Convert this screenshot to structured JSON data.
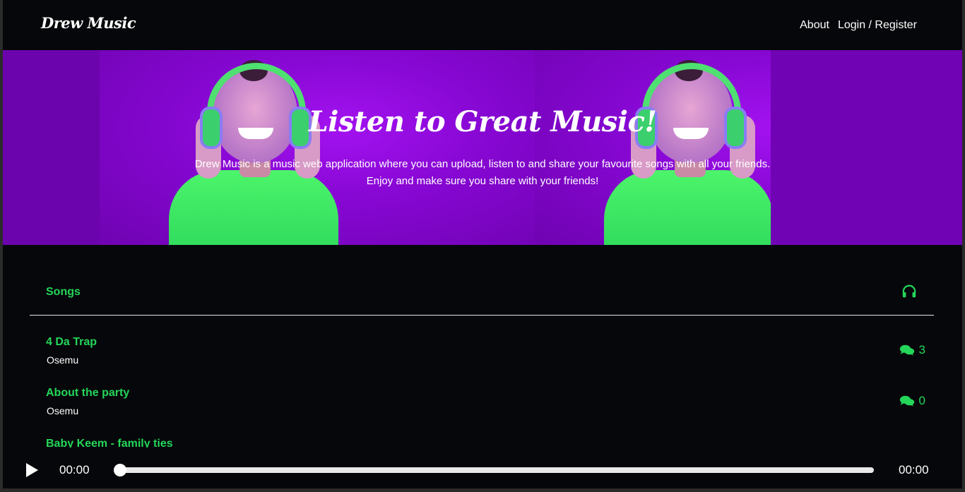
{
  "navbar": {
    "brand": "Drew Music",
    "links": [
      "About",
      "Login / Register"
    ]
  },
  "hero": {
    "title": "Listen to Great Music!",
    "text": "Drew Music is a music web application where you can upload, listen to and share your favourite songs with all your friends. Enjoy and make sure you share with your friends!"
  },
  "songs": {
    "heading": "Songs",
    "header_icon": "headphones-icon",
    "items": [
      {
        "title": "4 Da Trap",
        "artist": "Osemu",
        "comments": "3"
      },
      {
        "title": "About the party",
        "artist": "Osemu",
        "comments": "0"
      },
      {
        "title": "Baby Keem - family ties",
        "artist": "",
        "comments": ""
      }
    ]
  },
  "player": {
    "current_time": "00:00",
    "total_time": "00:00",
    "progress": 0
  },
  "colors": {
    "accent": "#24d65a",
    "background": "#06070a",
    "hero": "#7a05c2"
  }
}
